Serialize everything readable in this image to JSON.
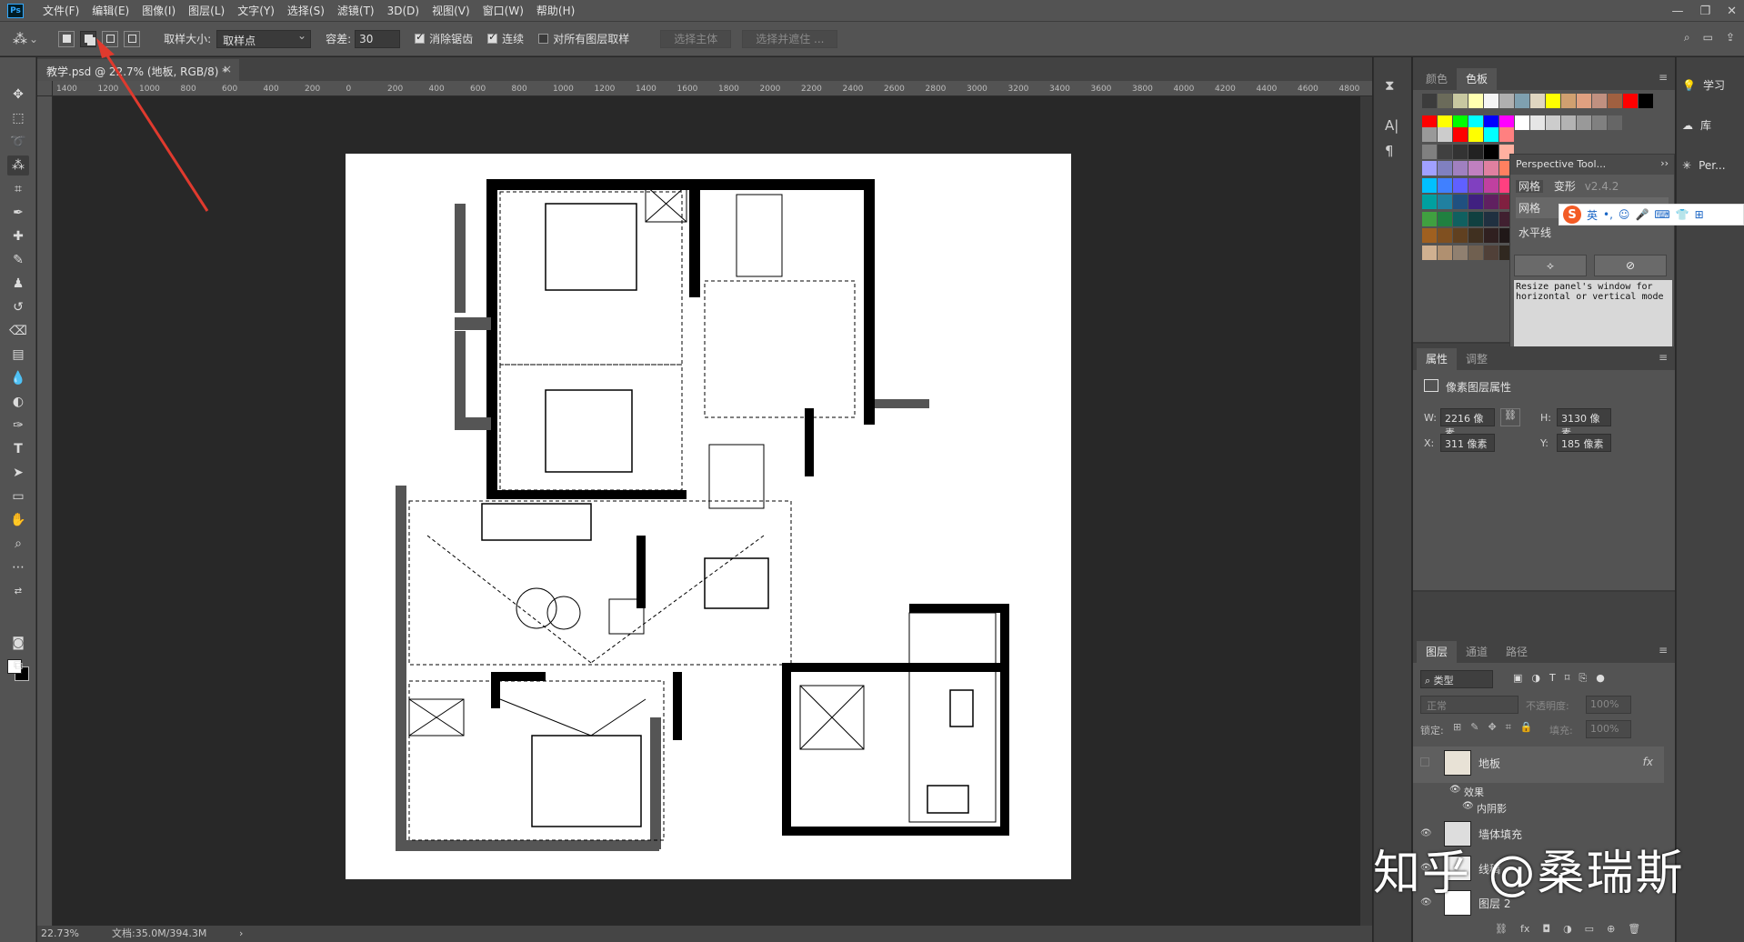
{
  "menu": [
    "文件(F)",
    "编辑(E)",
    "图像(I)",
    "图层(L)",
    "文字(Y)",
    "选择(S)",
    "滤镜(T)",
    "3D(D)",
    "视图(V)",
    "窗口(W)",
    "帮助(H)"
  ],
  "app_badge": "Ps",
  "options": {
    "sample_size_label": "取样大小:",
    "sample_size_value": "取样点",
    "tolerance_label": "容差:",
    "tolerance_value": "30",
    "antialias": "消除锯齿",
    "contiguous": "连续",
    "all_layers": "对所有图层取样",
    "select_subject": "选择主体",
    "select_mask": "选择并遮住 ..."
  },
  "doc_tab": {
    "title": "教学.psd @ 22.7% (地板, RGB/8) *",
    "close": "×"
  },
  "ruler_ticks": [
    "1400",
    "1200",
    "1000",
    "800",
    "600",
    "400",
    "200",
    "0",
    "200",
    "400",
    "600",
    "800",
    "1000",
    "1200",
    "1400",
    "1600",
    "1800",
    "2000",
    "2200",
    "2400",
    "2600",
    "2800",
    "3000",
    "3200",
    "3400",
    "3600",
    "3800",
    "4000",
    "4200",
    "4400",
    "4600",
    "4800"
  ],
  "status": {
    "zoom": "22.73%",
    "doc": "文档:35.0M/394.3M",
    "arrow": "›"
  },
  "swatches_panel": {
    "tabs": [
      "颜色",
      "色板"
    ],
    "active": "色板"
  },
  "perspective": {
    "title": "Perspective Tool...",
    "tab1": "网格",
    "tab2": "变形",
    "version": "v2.4.2",
    "item1": "网格",
    "item2": "水平线",
    "note": "Resize panel's window for horizontal or vertical mode"
  },
  "properties": {
    "tabs": [
      "属性",
      "调整"
    ],
    "title": "像素图层属性",
    "w_label": "W:",
    "w": "2216 像素",
    "h_label": "H:",
    "h": "3130 像素",
    "x_label": "X:",
    "x": "311 像素",
    "y_label": "Y:",
    "y": "185 像素"
  },
  "layers": {
    "tabs": [
      "图层",
      "通道",
      "路径"
    ],
    "filter": "类型",
    "blend": "正常",
    "opacity_label": "不透明度:",
    "opacity": "100%",
    "lock_label": "锁定:",
    "fill_label": "填充:",
    "fill": "100%",
    "items": [
      {
        "name": "地板",
        "fx": "fx"
      },
      {
        "name": "效果"
      },
      {
        "name": "内阴影"
      },
      {
        "name": "墙体填充"
      },
      {
        "name": "线稿"
      },
      {
        "name": "图层 2"
      }
    ]
  },
  "far_right": {
    "learn": "学习",
    "library": "库",
    "persp": "Per..."
  },
  "ime": {
    "logo": "S",
    "lang": "英"
  },
  "watermark": "知乎 @桑瑞斯"
}
